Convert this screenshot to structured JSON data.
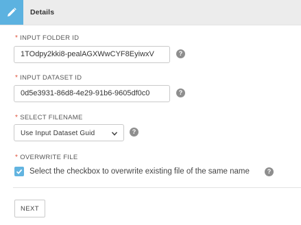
{
  "header": {
    "title": "Details",
    "icon": "pencil-icon",
    "icon_bg_color": "#5cb2e0"
  },
  "form": {
    "required_marker": "*",
    "input_folder_id": {
      "label": "INPUT FOLDER ID",
      "value": "1TOdpy2kki8-pealAGXWwCYF8EyiwxV"
    },
    "input_dataset_id": {
      "label": "INPUT DATASET ID",
      "value": "0d5e3931-86d8-4e29-91b6-9605df0c0"
    },
    "select_filename": {
      "label": "SELECT FILENAME",
      "selected": "Use Input Dataset Guid"
    },
    "overwrite_file": {
      "label": "OVERWRITE FILE",
      "checkbox_label": "Select the checkbox to overwrite existing file of the same name",
      "checked": true
    },
    "help_glyph": "?",
    "next_label": "NEXT"
  },
  "colors": {
    "accent": "#5cb2e0",
    "required": "#e0533b",
    "help_icon": "#8e8e8e"
  }
}
